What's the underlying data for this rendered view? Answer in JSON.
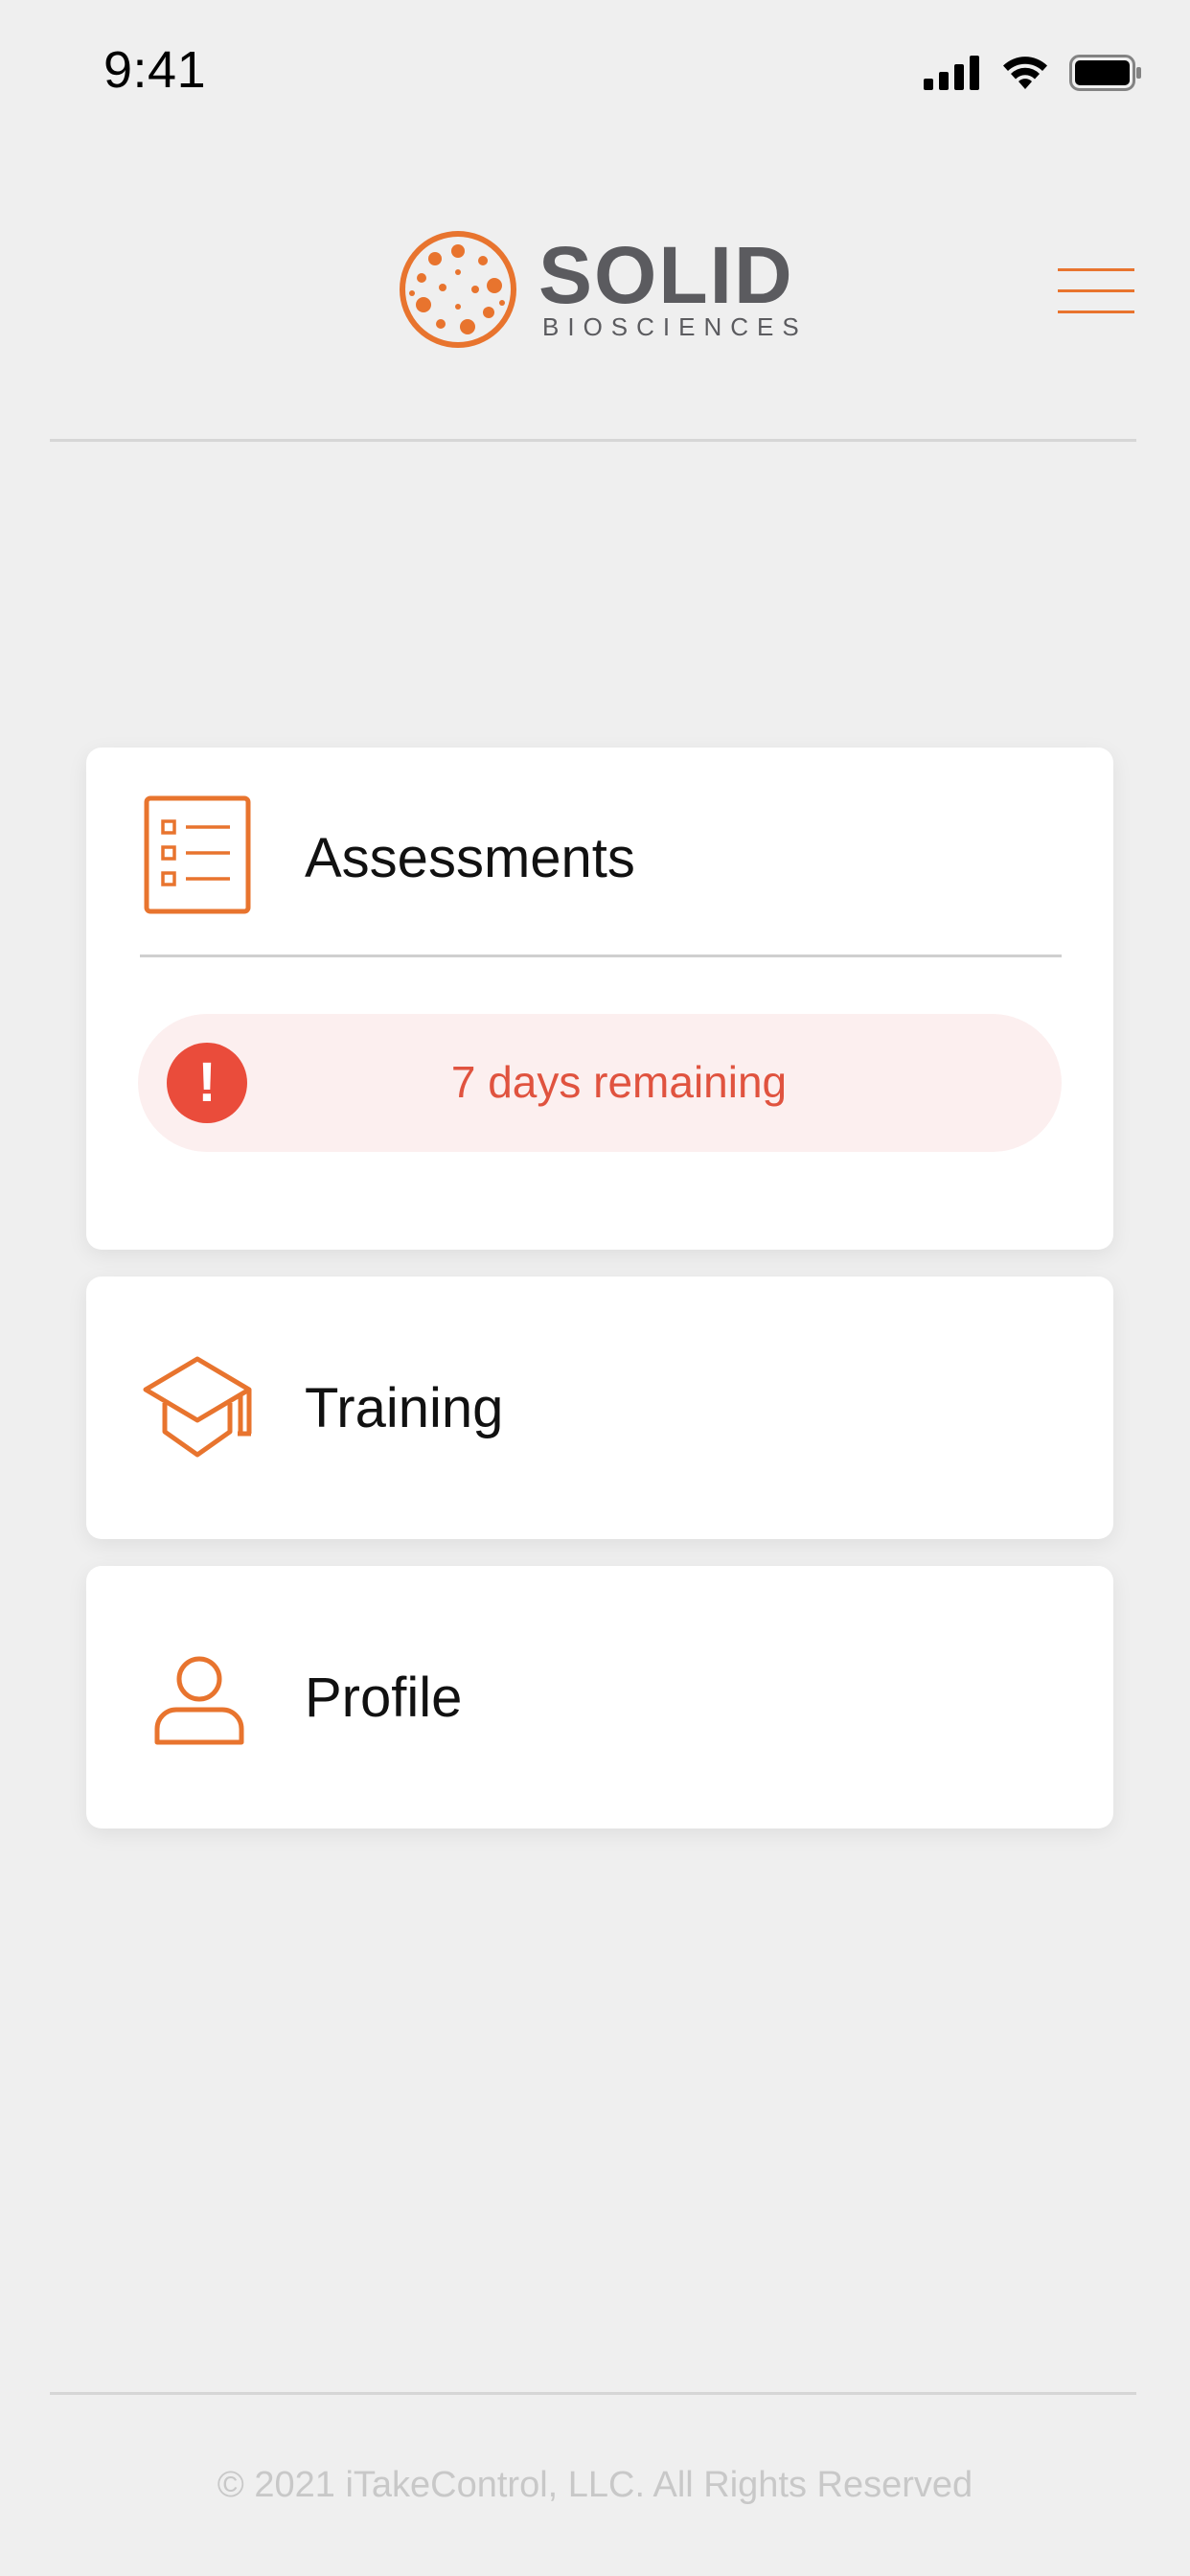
{
  "status_bar": {
    "time": "9:41",
    "icons": [
      "cellular-signal-icon",
      "wifi-icon",
      "battery-icon"
    ]
  },
  "header": {
    "logo_main": "SOLID",
    "logo_sub": "BIOSCIENCES",
    "menu_icon": "hamburger-menu-icon"
  },
  "cards": {
    "assessments": {
      "label": "Assessments",
      "icon": "checklist-icon",
      "alert": {
        "icon": "exclamation-icon",
        "glyph": "!",
        "text": "7 days remaining"
      }
    },
    "training": {
      "label": "Training",
      "icon": "graduation-cap-icon"
    },
    "profile": {
      "label": "Profile",
      "icon": "person-icon"
    }
  },
  "footer": {
    "copyright": "© 2021 iTakeControl, LLC.  All Rights Reserved"
  },
  "colors": {
    "accent": "#e8742e",
    "alert": "#ea4c3b",
    "alert_bg": "#fcefef",
    "background": "#efefef",
    "logo_text": "#5b5b5f"
  }
}
